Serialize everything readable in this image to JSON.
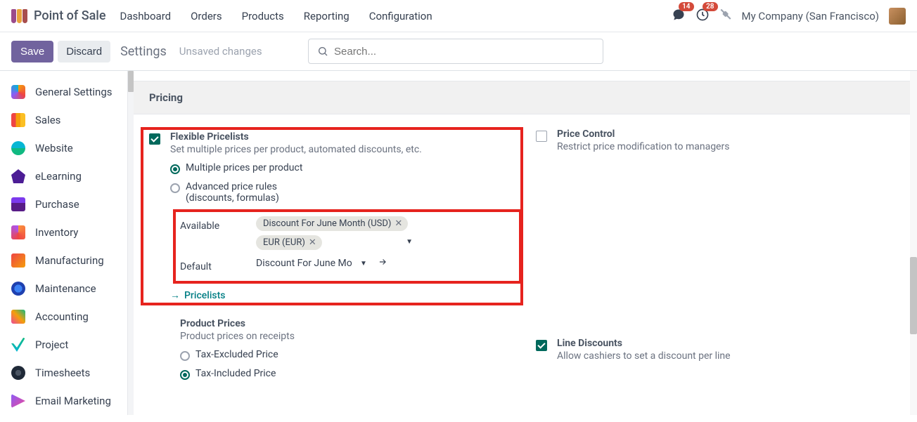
{
  "app": {
    "title": "Point of Sale"
  },
  "nav": {
    "dashboard": "Dashboard",
    "orders": "Orders",
    "products": "Products",
    "reporting": "Reporting",
    "configuration": "Configuration"
  },
  "topRight": {
    "msgCount": "14",
    "activityCount": "28",
    "company": "My Company (San Francisco)"
  },
  "controlBar": {
    "save": "Save",
    "discard": "Discard",
    "title": "Settings",
    "unsaved": "Unsaved changes",
    "searchPlaceholder": "Search..."
  },
  "sidebar": {
    "items": [
      {
        "label": "General Settings"
      },
      {
        "label": "Sales"
      },
      {
        "label": "Website"
      },
      {
        "label": "eLearning"
      },
      {
        "label": "Purchase"
      },
      {
        "label": "Inventory"
      },
      {
        "label": "Manufacturing"
      },
      {
        "label": "Maintenance"
      },
      {
        "label": "Accounting"
      },
      {
        "label": "Project"
      },
      {
        "label": "Timesheets"
      },
      {
        "label": "Email Marketing"
      }
    ]
  },
  "section": {
    "title": "Pricing"
  },
  "flexPricelists": {
    "title": "Flexible Pricelists",
    "desc": "Set multiple prices per product, automated discounts, etc.",
    "optMultiple": "Multiple prices per product",
    "optAdvanced1": "Advanced price rules",
    "optAdvanced2": "(discounts, formulas)",
    "availableLabel": "Available",
    "tag1": "Discount For June Month (USD)",
    "tag2": "EUR (EUR)",
    "defaultLabel": "Default",
    "defaultValue": "Discount For June Mo",
    "link": "Pricelists"
  },
  "priceControl": {
    "title": "Price Control",
    "desc": "Restrict price modification to managers"
  },
  "productPrices": {
    "title": "Product Prices",
    "desc": "Product prices on receipts",
    "optExcluded": "Tax-Excluded Price",
    "optIncluded": "Tax-Included Price"
  },
  "lineDiscounts": {
    "title": "Line Discounts",
    "desc": "Allow cashiers to set a discount per line"
  }
}
